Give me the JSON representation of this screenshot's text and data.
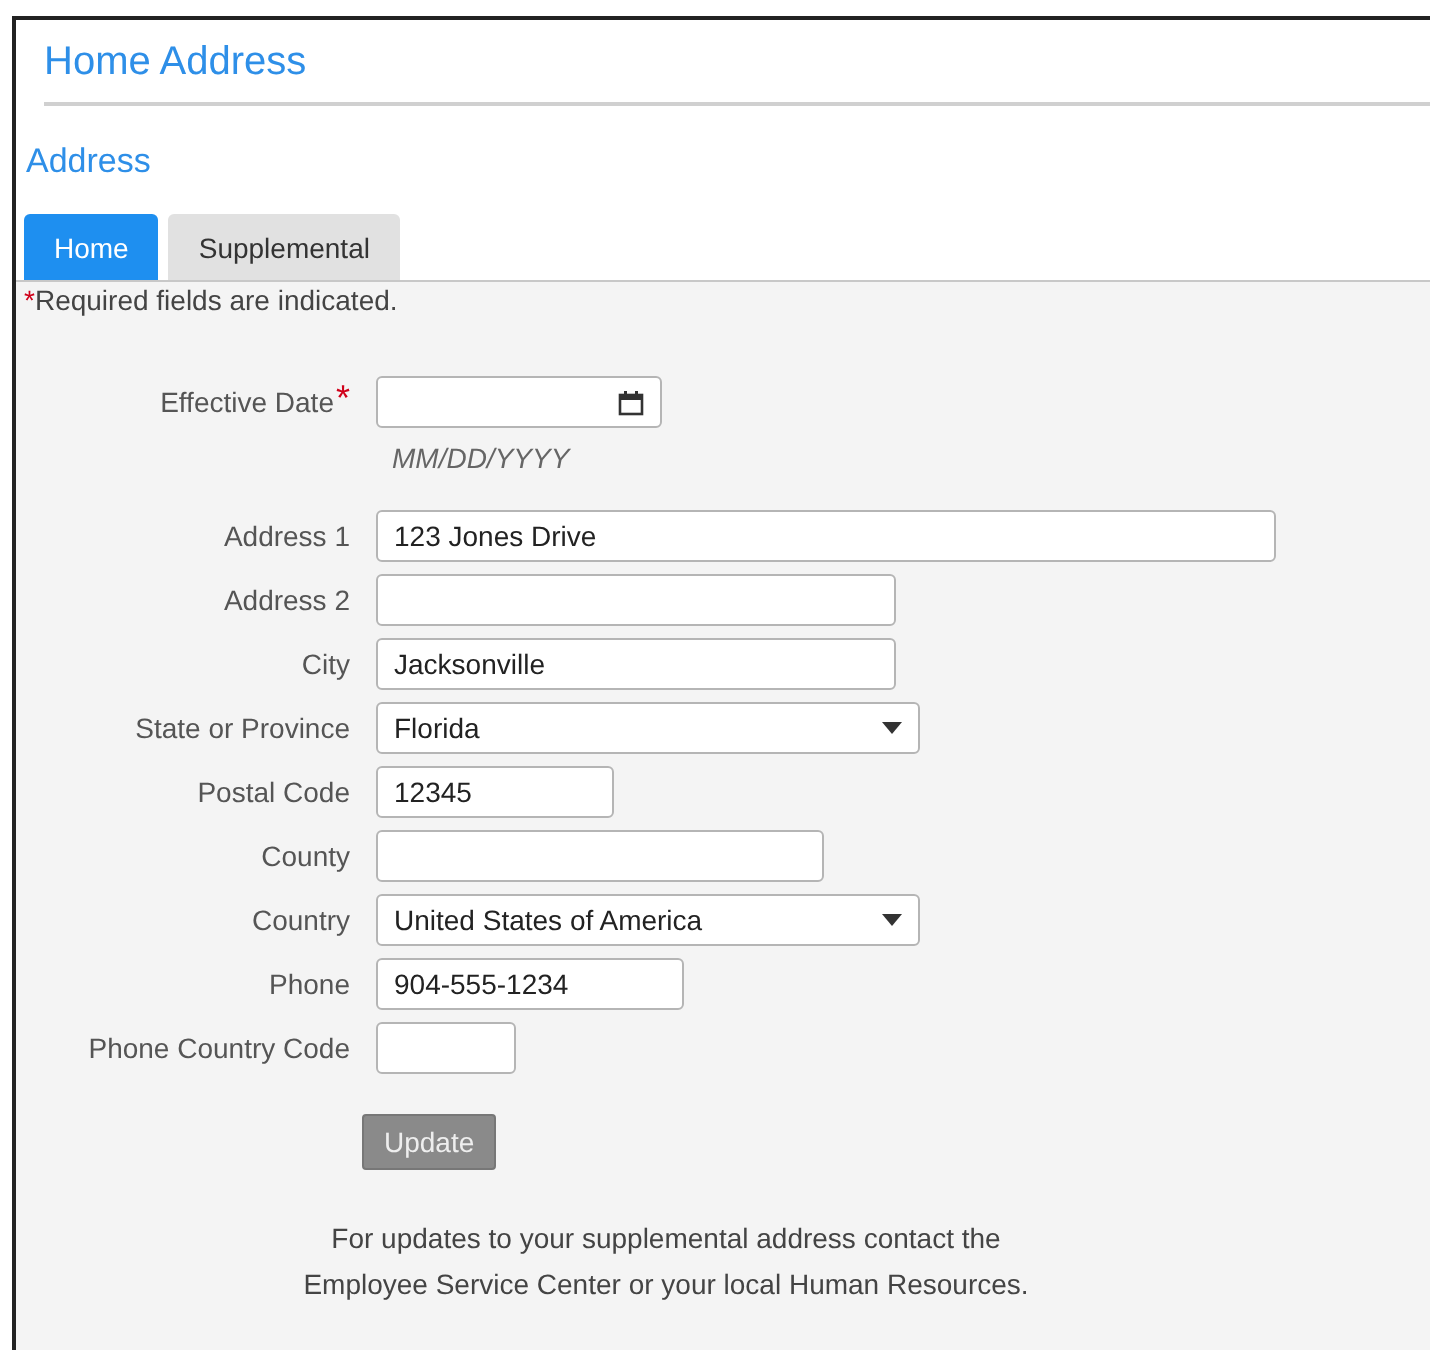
{
  "page_title": "Home Address",
  "section_title": "Address",
  "tabs": [
    {
      "label": "Home",
      "selected": true
    },
    {
      "label": "Supplemental",
      "selected": false
    }
  ],
  "required_note": {
    "mark": "*",
    "text": "Required fields are indicated."
  },
  "fields": [
    {
      "kind": "date",
      "label": "Effective Date",
      "required": true,
      "hint": "MM/DD/YYYY"
    },
    {
      "kind": "text",
      "label": "Address 1",
      "required": false,
      "value": "123 Jones Drive"
    },
    {
      "kind": "text",
      "label": "Address 2",
      "required": false
    },
    {
      "kind": "text",
      "label": "City",
      "required": false,
      "value": "Jacksonville"
    },
    {
      "kind": "select",
      "label": "State or Province",
      "required": false,
      "value": "Florida"
    },
    {
      "kind": "text",
      "label": "Postal Code",
      "required": false,
      "value": "12345"
    },
    {
      "kind": "text",
      "label": "County",
      "required": false
    },
    {
      "kind": "select",
      "label": "Country",
      "required": false,
      "value": "United States of America"
    },
    {
      "kind": "text",
      "label": "Phone",
      "required": false,
      "value": "904-555-1234"
    },
    {
      "kind": "text",
      "label": "Phone Country Code",
      "required": false
    }
  ],
  "update_button": {
    "label": "Update",
    "disabled": true
  },
  "footnote": [
    "For updates to your supplemental address contact the",
    "Employee Service Center or your local Human Resources."
  ]
}
